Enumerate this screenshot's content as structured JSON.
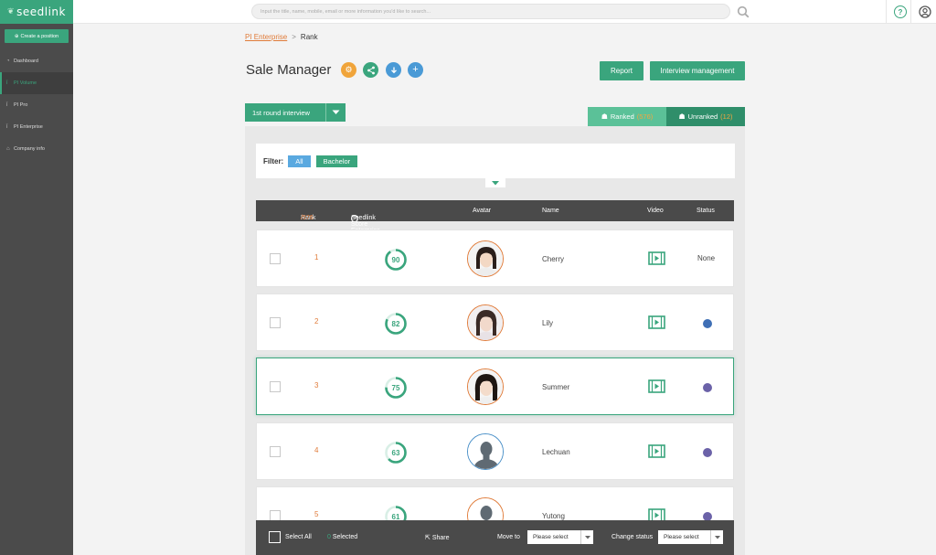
{
  "app": {
    "logo": "seedlink"
  },
  "sidebar": {
    "create_label": "Create a position",
    "items": [
      {
        "label": "Dashboard",
        "icon": "dashboard-icon",
        "active": false
      },
      {
        "label": "PI Volume",
        "icon": "pi-icon",
        "active": true
      },
      {
        "label": "PI Pro",
        "icon": "pi-icon",
        "active": false
      },
      {
        "label": "PI Enterprise",
        "icon": "pi-icon",
        "active": false
      },
      {
        "label": "Company info",
        "icon": "company-icon",
        "active": false
      }
    ]
  },
  "topbar": {
    "search_placeholder": "Input the title, name, mobile, email or more information you'd like to search...",
    "help": "?"
  },
  "breadcrumb": {
    "parent": "PI Enterprise",
    "separator": ">",
    "current": "Rank"
  },
  "page": {
    "title": "Sale Manager",
    "report_label": "Report",
    "interview_mgmt_label": "Interview management",
    "round_label": "1st round interview"
  },
  "tabs": {
    "ranked_label": "Ranked",
    "ranked_count": "(576)",
    "unranked_label": "Unranked",
    "unranked_count": "(12)"
  },
  "filter": {
    "label": "Filter:",
    "chips": [
      "All",
      "Bachelor"
    ]
  },
  "table": {
    "headers": {
      "rank": "Rank",
      "rank_total": "/576",
      "score": "Seedlink Score Enterprise",
      "score_help": "?",
      "avatar": "Avatar",
      "name": "Name",
      "video": "Video",
      "status": "Status"
    },
    "rows": [
      {
        "rank": "1",
        "score": "90",
        "name": "Cherry",
        "status": "None"
      },
      {
        "rank": "2",
        "score": "82",
        "name": "Lily",
        "status": ""
      },
      {
        "rank": "3",
        "score": "75",
        "name": "Summer",
        "status": ""
      },
      {
        "rank": "4",
        "score": "63",
        "name": "Lechuan",
        "status": ""
      },
      {
        "rank": "5",
        "score": "61",
        "name": "Yutong",
        "status": ""
      }
    ]
  },
  "colors": {
    "accent": "#3aa57d",
    "rank": "#e07b39",
    "status_blue": "#3f6fb5",
    "status_purple": "#6b62a8"
  },
  "bottom": {
    "select_all": "Select All",
    "selected_count": "0",
    "selected_label": "Selected",
    "share": "Share",
    "move_to": "Move to",
    "move_placeholder": "Please select",
    "change_status": "Change status",
    "status_placeholder": "Please select"
  }
}
